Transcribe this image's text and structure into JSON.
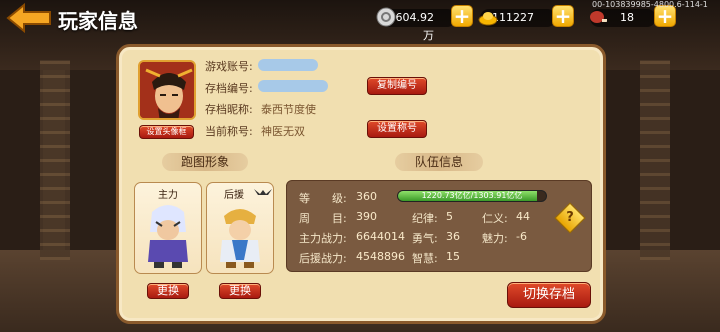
{
  "header": {
    "title": "玩家信息",
    "uid": "00-103839985-4800.6-114-1"
  },
  "currencies": [
    {
      "value": "58604.92万"
    },
    {
      "value": "111227"
    },
    {
      "value": "18"
    }
  ],
  "profile": {
    "account_label": "游戏账号:",
    "save_id_label": "存档编号:",
    "nickname_label": "存档昵称:",
    "nickname_value": "泰西节度使",
    "title_label": "当前称号:",
    "title_value": "神医无双",
    "copy_button": "复制编号",
    "set_title_button": "设置称号",
    "set_frame_button": "设置头像框"
  },
  "sections": {
    "run_image": "跑图形象",
    "team_info": "队伍信息"
  },
  "slots": [
    {
      "label": "主力",
      "button": "更换"
    },
    {
      "label": "后援",
      "button": "更换"
    }
  ],
  "team": {
    "level_label": "等　　级:",
    "level_value": "360",
    "exp_text": "1220.73亿亿/1303.91亿亿",
    "exp_progress": 0.936,
    "cycle_label": "周　　目:",
    "cycle_value": "390",
    "discipline_label": "纪律:",
    "discipline_value": "5",
    "benevolence_label": "仁义:",
    "benevolence_value": "44",
    "main_power_label": "主力战力:",
    "main_power_value": "6644014",
    "courage_label": "勇气:",
    "courage_value": "36",
    "charm_label": "魅力:",
    "charm_value": "-6",
    "backup_power_label": "后援战力:",
    "backup_power_value": "4548896",
    "wisdom_label": "智慧:",
    "wisdom_value": "15"
  },
  "switch_save_button": "切换存档",
  "help_glyph": "?"
}
